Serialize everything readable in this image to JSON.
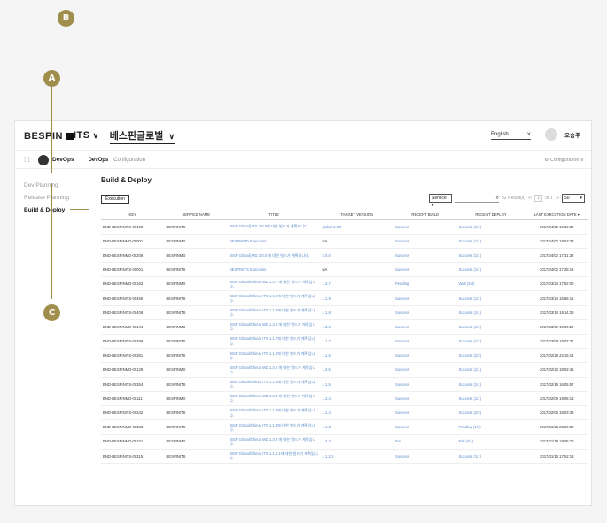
{
  "annotations": {
    "a": "A",
    "b": "B",
    "c": "C"
  },
  "header": {
    "brand": "BESPIN",
    "brand_suffix": "ITS",
    "project": "베스핀글로벌",
    "language": "English",
    "username": "오승주"
  },
  "subnav": {
    "section": "DevOps",
    "items": [
      "DevOps",
      "Configuration"
    ],
    "right_link": "Configuration"
  },
  "sidebar": {
    "items": [
      "Dev Planning",
      "Release Planning",
      "Build & Deploy"
    ]
  },
  "main": {
    "title": "Build & Deploy",
    "execution_button": "Execution",
    "service_select": "Service",
    "result_count": "32 Result(s)",
    "pager": "of 1",
    "page_current": "1",
    "page_size": "50"
  },
  "table": {
    "columns": [
      "KEY",
      "SERVICE NAME",
      "TITLE",
      "TARGET VERSION",
      "RECENT BUILD",
      "RECENT DEPLOY",
      "LAST EXECUTION DATE"
    ],
    "rows": [
      [
        "BND-BESPINITS-00498",
        "BESPINITS",
        "[BSP Global] ITS 2.0.0에 대한 빌드가 계획되니다.",
        "global-2.0.0",
        "Success",
        "Success (1/1)",
        "2017/04/02 19:02:36"
      ],
      [
        "BND-BESPINMD-00001",
        "BESPINMD",
        "BESPINMD Execution",
        "NA",
        "Success",
        "Success (1/1)",
        "2017/04/02 18:53:33"
      ],
      [
        "BND-BESPINMD-00206",
        "BESPINMD",
        "[BSP Global] MD 2.0.0 에 대한 빌드가 계획되니다.",
        "2.0.0",
        "Success",
        "Success (1/1)",
        "2017/04/02 17:31:32"
      ],
      [
        "BND-BESPINITS-00001",
        "BESPINITS",
        "BESPINITS Execution",
        "NA",
        "Success",
        "Success (1/1)",
        "2017/04/02 17:28:13"
      ],
      [
        "BND-BESPINMD-00163",
        "BESPINMD",
        "[BSP Global/China] MD 1.3.7 에 대한 빌드가 계획입니다.",
        "1.3.7",
        "Pending",
        "Wait (4/4)",
        "2017/03/24 17:52:00"
      ],
      [
        "BND-BESPINITS-00456",
        "BESPINITS",
        "[BSP Global/China] ITS 1.1.9에 대한 빌드가 계획입니다.",
        "1.1.9",
        "Success",
        "Success (1/1)",
        "2017/03/24 15:56:15"
      ],
      [
        "BND-BESPINITS-00406",
        "BESPINITS",
        "[BSP Global/China] ITS 1.1.8에 대한 빌드가 계획입니다.",
        "1.1.8",
        "Success",
        "Success (1/1)",
        "2017/03/14 19:14:29"
      ],
      [
        "BND-BESPINMD-00144",
        "BESPINMD",
        "[BSP Global/China] MD 1.3.6 에 대한 빌드가 계획입니다.",
        "1.3.6",
        "Success",
        "Success (1/1)",
        "2017/03/09 19:00:22"
      ],
      [
        "BND-BESPINITS-00399",
        "BESPINITS",
        "[BSP Global/China] ITS 1.1.7에 대한 빌드가 계획입니다.",
        "1.1.7",
        "Success",
        "Success (1/1)",
        "2017/03/09 16:07:31"
      ],
      [
        "BND-BESPINITS-00381",
        "BESPINITS",
        "[BSP Global/China] ITS 1.1.6에 대한 빌드가 계획입니다.",
        "1.1.6",
        "Success",
        "Success (2/2)",
        "2017/02/28 22:15:14"
      ],
      [
        "BND-BESPINMD-00129",
        "BESPINMD",
        "[BSP Global/China] MD 1.3.5 에 대한 빌드가 계획입니다.",
        "1.3.5",
        "Success",
        "Success (1/1)",
        "2017/02/23 19:02:41"
      ],
      [
        "BND-BESPINITS-00354",
        "BESPINITS",
        "[BSP Global/China] ITS 1.1.5에 대한 빌드가 계획입니다.",
        "1.1.5",
        "Success",
        "Success (1/1)",
        "2017/02/16 16:05:57"
      ],
      [
        "BND-BESPINMD-00111",
        "BESPINMD",
        "[BSP Global/China] MD 1.3.4 에 대한 빌드가 계획입니다.",
        "1.3.4",
        "Success",
        "Success (1/1)",
        "2017/02/09 19:05:13"
      ],
      [
        "BND-BESPINITS-00342",
        "BESPINITS",
        "[BSP Global/China] ITS 1.1.4에 대한 빌드가 계획입니다.",
        "1.1.4",
        "Success",
        "Success (2/2)",
        "2017/02/06 18:03:36"
      ],
      [
        "BND-BESPINMD-00333",
        "BESPINITS",
        "[BSP Global/China] ITS 1.1.3에 대한 빌드가 계획입니다.",
        "1.1.3",
        "Success",
        "Pending (1/1)",
        "2017/01/23 23:26:09"
      ],
      [
        "BND-BESPINMD-00101",
        "BESPINMD",
        "[BSP Global/China] MD 1.3.3 에 대한 빌드가 계획입니다.",
        "1.3.3",
        "Fail",
        "Fail (4/4)",
        "2017/01/19 19:05:20"
      ],
      [
        "BND-BESPINITS-00315",
        "BESPINITS",
        "[BSP Global/China] ITS 1.1.2.1에 대한 빌드가 계획됩니다.",
        "1.1.2.1",
        "Success",
        "Success (1/1)",
        "2017/01/13 17:52:13"
      ]
    ]
  },
  "colors": {
    "accent": "#a08f4c",
    "link": "#5b8bc9"
  }
}
